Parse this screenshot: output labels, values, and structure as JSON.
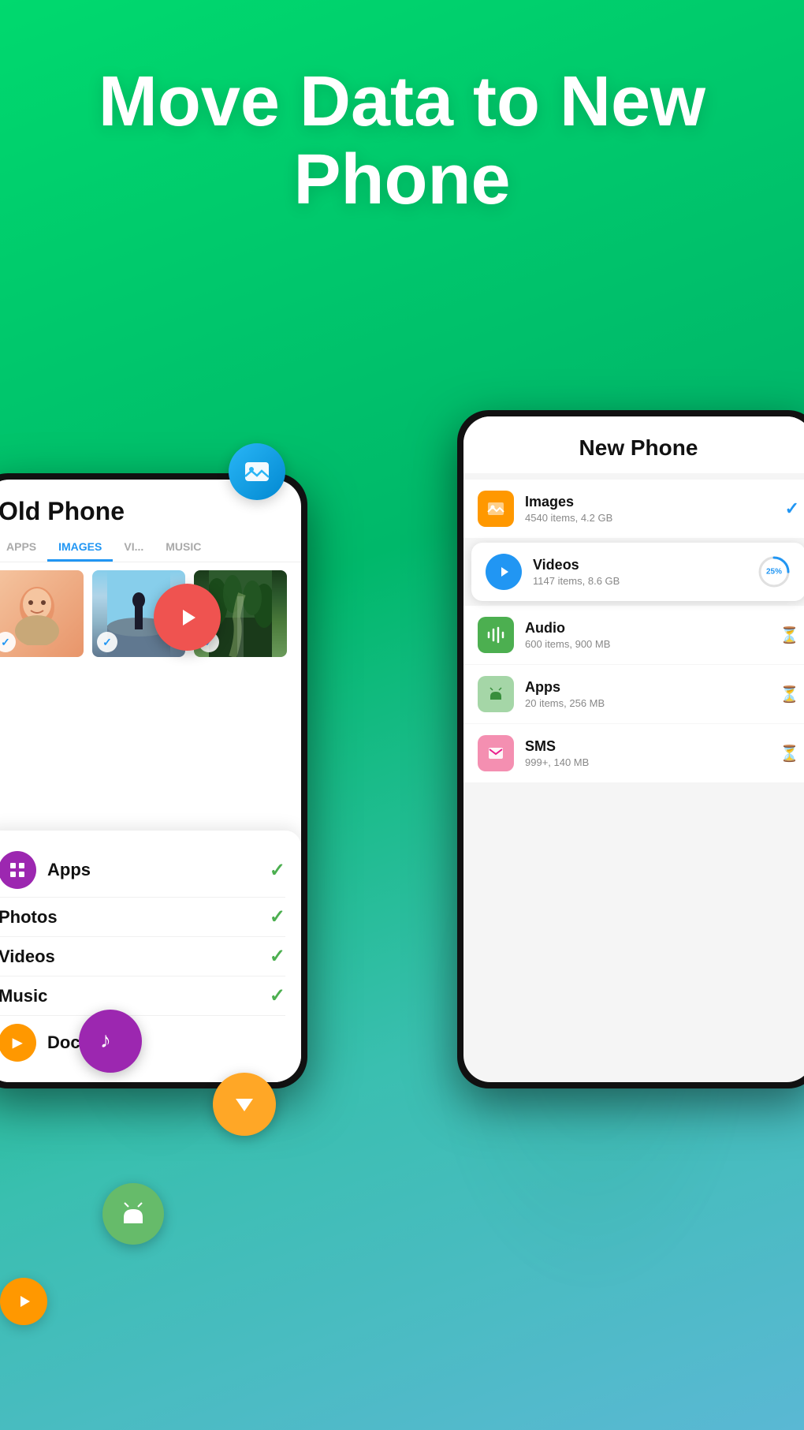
{
  "hero": {
    "title": "Move Data to New Phone"
  },
  "old_phone": {
    "title": "Old Phone",
    "tabs": [
      "APPS",
      "IMAGES",
      "VI...",
      "MUSIC"
    ],
    "active_tab": "IMAGES",
    "images": [
      {
        "type": "face",
        "checked": true
      },
      {
        "type": "silhouette",
        "checked": true
      },
      {
        "type": "forest",
        "checked": true
      }
    ],
    "app_list": [
      {
        "name": "Apps",
        "has_icon": true,
        "icon_type": "purple",
        "checked": true
      },
      {
        "name": "Photos",
        "checked": true
      },
      {
        "name": "Videos",
        "checked": true
      },
      {
        "name": "Music",
        "has_icon": true,
        "icon_type": "purple-small",
        "checked": true
      },
      {
        "name": "Documents",
        "has_icon": true,
        "icon_type": "orange-play",
        "checked": false
      }
    ]
  },
  "new_phone": {
    "title": "New Phone",
    "items": [
      {
        "name": "Images",
        "sub": "4540 items, 4.2 GB",
        "icon_type": "orange",
        "status": "check",
        "active": false
      },
      {
        "name": "Videos",
        "sub": "1147 items, 8.6 GB",
        "icon_type": "blue-play",
        "status": "progress25",
        "active": true
      },
      {
        "name": "Audio",
        "sub": "600 items, 900 MB",
        "icon_type": "green-music",
        "status": "hourglass",
        "active": false
      },
      {
        "name": "Apps",
        "sub": "20 items, 256 MB",
        "icon_type": "android",
        "status": "hourglass",
        "active": false
      },
      {
        "name": "SMS",
        "sub": "999+, 140 MB",
        "icon_type": "pink-mail",
        "status": "hourglass",
        "active": false
      }
    ],
    "progress_value": 25
  },
  "floating_icons": {
    "image_icon": "🖼",
    "play_icon": "▶",
    "music_icon": "♪",
    "down_icon": "▼",
    "android_icon": "🤖"
  }
}
